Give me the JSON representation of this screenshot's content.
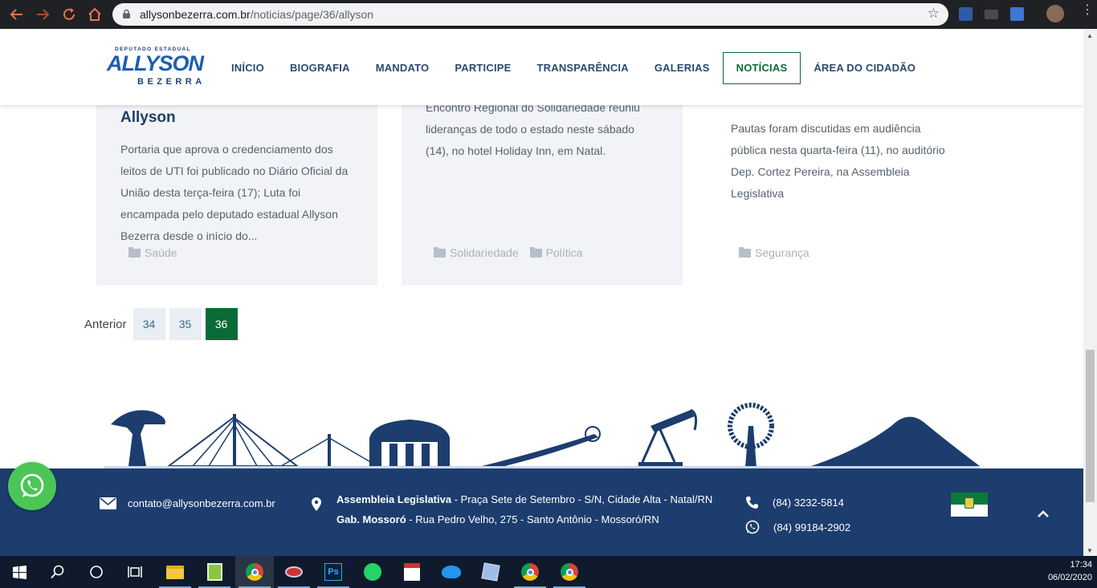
{
  "browser": {
    "url_domain": "allysonbezerra.com.br",
    "url_path": "/noticias/page/36/allyson"
  },
  "site": {
    "logo": {
      "top": "DEPUTADO ESTADUAL",
      "name": "ALLYSON",
      "surname": "BEZERRA"
    },
    "nav": [
      {
        "label": "INÍCIO",
        "active": false
      },
      {
        "label": "BIOGRAFIA",
        "active": false
      },
      {
        "label": "MANDATO",
        "active": false
      },
      {
        "label": "PARTICIPE",
        "active": false
      },
      {
        "label": "TRANSPARÊNCIA",
        "active": false
      },
      {
        "label": "GALERIAS",
        "active": false
      },
      {
        "label": "NOTÍCIAS",
        "active": true
      },
      {
        "label": "ÁREA DO CIDADÃO",
        "active": false
      }
    ]
  },
  "cards": [
    {
      "title": "Allyson",
      "excerpt": [
        "Portaria que aprova o credenciamento dos",
        "leitos de UTI foi publicado no Diário Oficial da",
        "União desta terça-feira (17); Luta foi",
        "encampada pelo deputado estadual Allyson",
        "Bezerra desde o início do..."
      ],
      "categories": [
        "Saúde"
      ]
    },
    {
      "title": "",
      "excerpt": [
        "Encontro Regional do Solidariedade reuniu",
        "lideranças de todo o estado neste sábado",
        "(14), no hotel Holiday Inn, em Natal."
      ],
      "categories": [
        "Solidariedade",
        "Política"
      ]
    },
    {
      "title": "",
      "excerpt": [
        "Pautas foram discutidas em audiência",
        "pública nesta quarta-feira (11), no auditório",
        "Dep. Cortez Pereira, na Assembleia",
        "Legislativa"
      ],
      "categories": [
        "Segurança"
      ]
    }
  ],
  "pagination": {
    "prev_label": "Anterior",
    "pages": [
      "34",
      "35",
      "36"
    ],
    "current": "36"
  },
  "footer": {
    "email": "contato@allysonbezerra.com.br",
    "address1_bold": "Assembleia Legislativa",
    "address1": " - Praça Sete de Setembro - S/N, Cidade Alta - Natal/RN",
    "address2_bold": "Gab. Mossoró",
    "address2": " - Rua Pedro Velho, 275 - Santo Antônio - Mossoró/RN",
    "phone": "(84) 3232-5814",
    "whatsapp": "(84) 99184-2902"
  },
  "taskbar": {
    "time": "17:34",
    "date": "06/02/2020"
  },
  "colors": {
    "nav_text": "#2b4a6f",
    "accent_green": "#0b6b37",
    "footer_bg": "#1c3d6e",
    "card_bg": "#f2f3f7"
  }
}
